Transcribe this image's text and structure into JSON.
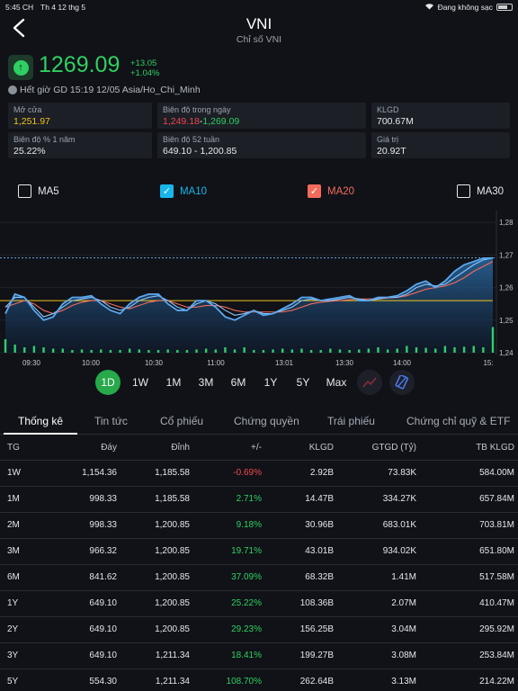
{
  "status": {
    "time": "5:45 CH",
    "date": "Th 4 12 thg 5",
    "charging": "Đang không sạc"
  },
  "header": {
    "title": "VNI",
    "subtitle": "Chỉ số VNI"
  },
  "quote": {
    "price": "1269.09",
    "change": "+13.05",
    "change_pct": "+1.04%",
    "session": "Hết giờ GD 15:19 12/05 Asia/Ho_Chi_Minh"
  },
  "info": {
    "open": {
      "label": "Mở cửa",
      "value": "1,251.97"
    },
    "day_range": {
      "label": "Biên độ trong ngày",
      "low": "1,249.18",
      "sep": "-",
      "high": "1,269.09"
    },
    "volume": {
      "label": "KLGD",
      "value": "700.67M"
    },
    "year_pct": {
      "label": "Biên độ % 1 năm",
      "value": "25.22%"
    },
    "range_52w": {
      "label": "Biên độ 52 tuần",
      "value": "649.10 - 1,200.85"
    },
    "value": {
      "label": "Giá trị",
      "value": "20.92T"
    }
  },
  "ma": [
    {
      "label": "MA5",
      "checked": false
    },
    {
      "label": "MA10",
      "checked": true,
      "color": "#17b7ea"
    },
    {
      "label": "MA20",
      "checked": true,
      "color": "#f26b5b"
    },
    {
      "label": "MA30",
      "checked": false
    }
  ],
  "chart_data": {
    "type": "line",
    "x_ticks": [
      "09:30",
      "10:00",
      "10:30",
      "11:00",
      "13:01",
      "13:30",
      "14:00",
      "15:"
    ],
    "y_ticks": [
      "1,28",
      "1,27",
      "1,26",
      "1,25",
      "1,24"
    ],
    "ylim": [
      1240,
      1282
    ],
    "reference_open": 1256.0,
    "prev_close_line": 1269.1,
    "series": [
      {
        "name": "MA10",
        "color": "#17b7ea",
        "values": [
          1254,
          1257,
          1257,
          1254,
          1251,
          1252,
          1254,
          1256,
          1256.5,
          1257,
          1256,
          1254,
          1253,
          1254,
          1256,
          1257,
          1257.5,
          1256,
          1254,
          1253,
          1255,
          1256,
          1255,
          1253,
          1251.5,
          1252,
          1253,
          1252,
          1252,
          1253,
          1254,
          1256,
          1256.5,
          1256,
          1256,
          1256.5,
          1257,
          1256.5,
          1256,
          1256.5,
          1257,
          1257,
          1258,
          1260,
          1261,
          1260.5,
          1261,
          1263,
          1265,
          1267,
          1268.5,
          1269.1
        ]
      },
      {
        "name": "MA20",
        "color": "#f26b5b",
        "values": [
          1254,
          1255,
          1256,
          1255,
          1253,
          1252,
          1253,
          1254.5,
          1255.5,
          1256,
          1256,
          1255,
          1254,
          1253.5,
          1254.5,
          1255.5,
          1256,
          1256,
          1255,
          1254,
          1254,
          1254.5,
          1254.5,
          1254,
          1253,
          1252.5,
          1252.5,
          1252.5,
          1252.5,
          1252.5,
          1253,
          1254,
          1255,
          1255.5,
          1255.8,
          1256,
          1256.3,
          1256.5,
          1256.5,
          1256.5,
          1256.8,
          1257,
          1257.5,
          1258.5,
          1259.5,
          1260,
          1260.5,
          1261.5,
          1263,
          1265,
          1266.5,
          1268
        ]
      }
    ],
    "price": [
      1252,
      1258,
      1257,
      1253,
      1250,
      1251,
      1255,
      1257,
      1257,
      1257.5,
      1255,
      1253,
      1252,
      1255,
      1257,
      1258,
      1258,
      1255,
      1253,
      1253,
      1256,
      1256,
      1254,
      1251,
      1250,
      1251.5,
      1253,
      1251.5,
      1252,
      1253.5,
      1255,
      1257,
      1257,
      1256,
      1256.5,
      1257,
      1257.5,
      1256,
      1256,
      1257,
      1257,
      1257.5,
      1259,
      1261,
      1262,
      1260,
      1262,
      1265,
      1267,
      1268,
      1269,
      1269.09
    ],
    "volume": [
      0.5,
      0.3,
      0.2,
      0.25,
      0.2,
      0.15,
      0.15,
      0.1,
      0.12,
      0.1,
      0.12,
      0.1,
      0.1,
      0.15,
      0.12,
      0.1,
      0.1,
      0.12,
      0.1,
      0.1,
      0.12,
      0.15,
      0.12,
      0.2,
      0.12,
      0.2,
      0.1,
      0.1,
      0.12,
      0.15,
      0.12,
      0.15,
      0.1,
      0.1,
      0.15,
      0.12,
      0.1,
      0.12,
      0.15,
      0.2,
      0.12,
      0.15,
      0.25,
      0.2,
      0.18,
      0.15,
      0.25,
      0.2,
      0.22,
      0.25,
      0.2,
      0.95
    ]
  },
  "ranges": [
    "1D",
    "1W",
    "1M",
    "3M",
    "6M",
    "1Y",
    "5Y",
    "Max"
  ],
  "tabs": [
    "Thống kê",
    "Tin tức",
    "Cổ phiếu",
    "Chứng quyền",
    "Trái phiếu",
    "Chứng chỉ quỹ & ETF"
  ],
  "table": {
    "headers": [
      "TG",
      "Đáy",
      "Đỉnh",
      "+/-",
      "KLGD",
      "GTGD (Tỷ)",
      "TB KLGD"
    ],
    "rows": [
      [
        "1W",
        "1,154.36",
        "1,185.58",
        "-0.69%",
        "2.92B",
        "73.83K",
        "584.00M"
      ],
      [
        "1M",
        "998.33",
        "1,185.58",
        "2.71%",
        "14.47B",
        "334.27K",
        "657.84M"
      ],
      [
        "2M",
        "998.33",
        "1,200.85",
        "9.18%",
        "30.96B",
        "683.01K",
        "703.81M"
      ],
      [
        "3M",
        "966.32",
        "1,200.85",
        "19.71%",
        "43.01B",
        "934.02K",
        "651.80M"
      ],
      [
        "6M",
        "841.62",
        "1,200.85",
        "37.09%",
        "68.32B",
        "1.41M",
        "517.58M"
      ],
      [
        "1Y",
        "649.10",
        "1,200.85",
        "25.22%",
        "108.36B",
        "2.07M",
        "410.47M"
      ],
      [
        "2Y",
        "649.10",
        "1,200.85",
        "29.23%",
        "156.25B",
        "3.04M",
        "295.92M"
      ],
      [
        "3Y",
        "649.10",
        "1,211.34",
        "18.41%",
        "199.27B",
        "3.08M",
        "253.84M"
      ],
      [
        "5Y",
        "554.30",
        "1,211.34",
        "108.70%",
        "262.64B",
        "3.13M",
        "214.22M"
      ]
    ]
  }
}
